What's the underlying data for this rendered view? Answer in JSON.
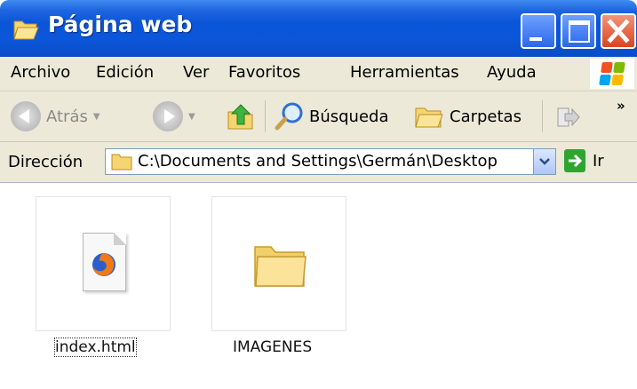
{
  "window": {
    "title": "Página web"
  },
  "menu": {
    "items": [
      {
        "label": "Archivo"
      },
      {
        "label": "Edición"
      },
      {
        "label": "Ver"
      },
      {
        "label": "Favoritos"
      },
      {
        "label": "Herramientas"
      },
      {
        "label": "Ayuda"
      }
    ]
  },
  "toolbar": {
    "back_label": "Atrás",
    "search_label": "Búsqueda",
    "folders_label": "Carpetas",
    "overflow_label": "»"
  },
  "address": {
    "label": "Dirección",
    "value": "C:\\Documents and Settings\\Germán\\Desktop",
    "go_label": "Ir"
  },
  "files": [
    {
      "name": "index.html",
      "icon": "firefox-html-file-icon",
      "selected": true
    },
    {
      "name": "IMAGENES",
      "icon": "folder-icon",
      "selected": false
    }
  ],
  "colors": {
    "titlebar": "#0a55d8",
    "chrome": "#ece9d8",
    "close_button": "#d9441d"
  }
}
